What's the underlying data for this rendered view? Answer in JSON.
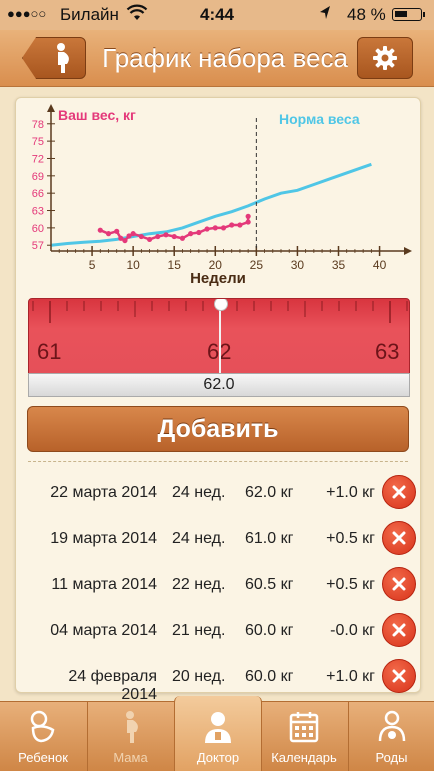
{
  "status_bar": {
    "carrier": "Билайн",
    "time": "4:44",
    "battery": "48 %"
  },
  "header": {
    "title": "График набора веса"
  },
  "chart_data": {
    "type": "line",
    "title": "",
    "xlabel": "Недели",
    "ylabel": "Ваш вес, кг",
    "x_ticks": [
      5,
      10,
      15,
      20,
      25,
      30,
      35,
      40
    ],
    "y_ticks": [
      57,
      60,
      63,
      66,
      69,
      72,
      75,
      78
    ],
    "xlim": [
      0,
      42
    ],
    "ylim": [
      56,
      79
    ],
    "current_week_marker": 25,
    "series": [
      {
        "name": "Ваш вес, кг",
        "color": "#e4397a",
        "x": [
          6,
          7,
          8,
          8.5,
          9,
          9.5,
          10,
          11,
          12,
          13,
          14,
          15,
          16,
          17,
          18,
          19,
          20,
          21,
          22,
          23,
          24,
          24
        ],
        "y": [
          59.6,
          59.0,
          59.4,
          58.2,
          57.8,
          58.6,
          59.0,
          58.5,
          58.0,
          58.5,
          58.8,
          58.5,
          58.2,
          59.0,
          59.2,
          59.8,
          60.0,
          60.0,
          60.5,
          60.5,
          61.0,
          62.0
        ]
      },
      {
        "name": "Норма веса",
        "color": "#4fc6e6",
        "x": [
          0,
          2,
          4,
          6,
          8,
          10,
          12,
          14,
          16,
          18,
          20,
          22,
          24,
          26,
          28,
          30,
          32,
          34,
          36,
          38,
          39
        ],
        "y": [
          57.0,
          57.3,
          57.5,
          57.7,
          58.0,
          58.5,
          59.0,
          59.3,
          60.0,
          61.0,
          62.0,
          62.8,
          63.8,
          65.0,
          66.0,
          66.5,
          67.5,
          68.5,
          69.5,
          70.5,
          71.0
        ]
      }
    ]
  },
  "ruler": {
    "labels": [
      "61",
      "62",
      "63"
    ],
    "value": "62.0"
  },
  "add_button": "Добавить",
  "entries": [
    {
      "date": "22 марта 2014",
      "week": "24 нед.",
      "weight": "62.0 кг",
      "delta": "+1.0 кг"
    },
    {
      "date": "19 марта 2014",
      "week": "24 нед.",
      "weight": "61.0 кг",
      "delta": "+0.5 кг"
    },
    {
      "date": "11 марта 2014",
      "week": "22 нед.",
      "weight": "60.5 кг",
      "delta": "+0.5 кг"
    },
    {
      "date": "04 марта 2014",
      "week": "21 нед.",
      "weight": "60.0 кг",
      "delta": "-0.0 кг"
    },
    {
      "date": "24 февраля 2014",
      "week": "20 нед.",
      "weight": "60.0 кг",
      "delta": "+1.0 кг"
    }
  ],
  "tabs": [
    {
      "label": "Ребенок",
      "icon": "baby-icon"
    },
    {
      "label": "Мама",
      "icon": "pregnant-woman-icon"
    },
    {
      "label": "Доктор",
      "icon": "doctor-icon"
    },
    {
      "label": "Календарь",
      "icon": "calendar-icon"
    },
    {
      "label": "Роды",
      "icon": "mother-baby-icon"
    }
  ],
  "colors": {
    "accent": "#d17e3e",
    "weight_line": "#e4397a",
    "norm_line": "#4fc6e6",
    "ruler": "#e0464f",
    "delete": "#e0401f"
  }
}
